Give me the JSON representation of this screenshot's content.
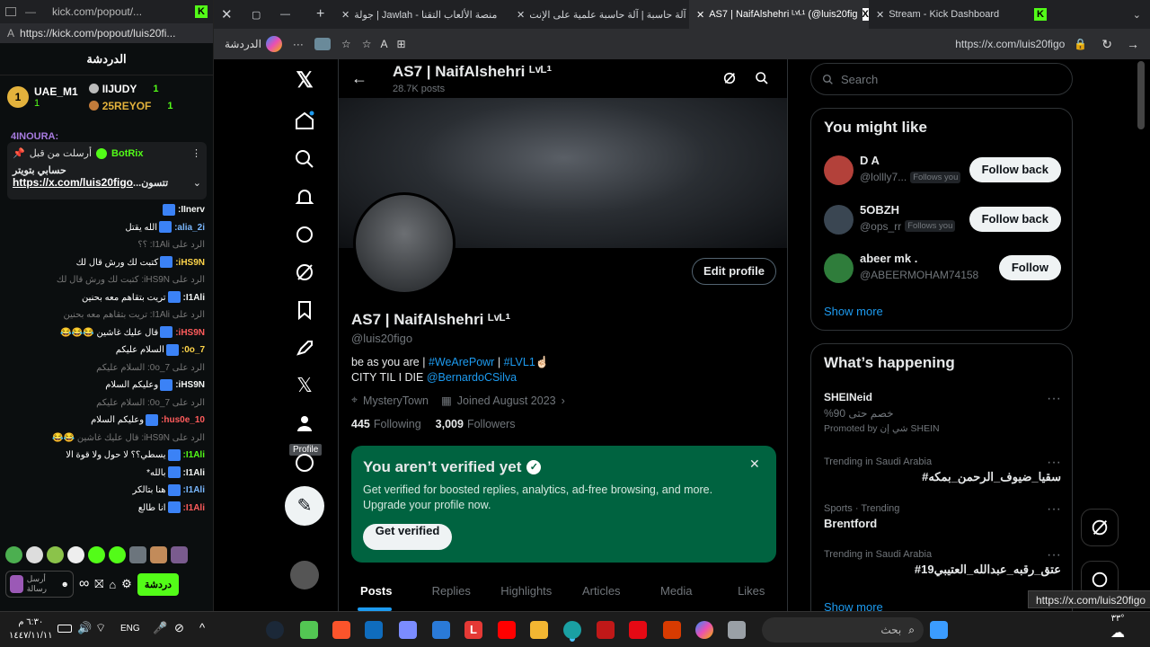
{
  "kick": {
    "tab_title": "kick.com/popout/...",
    "url": "https://kick.com/popout/luis20fi...",
    "chat_title": "الدردشة",
    "leaderboard": [
      {
        "rank": "1",
        "name": "UAE_M1",
        "count": "1"
      },
      {
        "rank": "",
        "name": "IIJUDY",
        "count": "1"
      },
      {
        "rank": "",
        "name": "25REYOF",
        "count": "1"
      }
    ],
    "overflow_user": "4INOURA:",
    "pinned": {
      "by": "أرسلت من قبل",
      "bot": "BotRix",
      "line1": "حسابي بتويتر",
      "link": "https://x.com/luis20figo",
      "suffix": "...تتسون"
    },
    "messages": [
      {
        "user": "IInerv:",
        "text": "",
        "sub": false
      },
      {
        "user": "alia_2i:",
        "text": "الله يقتل",
        "sub": false
      },
      {
        "user": "",
        "text": "الرد على I1Ali: ؟؟",
        "sub": true
      },
      {
        "user": "iHS9N:",
        "text": "كتبت لك ورش قال لك",
        "sub": false
      },
      {
        "user": "",
        "text": "الرد على iHS9N: كتبت لك ورش قال لك",
        "sub": true
      },
      {
        "user": "I1Ali:",
        "text": "تريت بتقاهم معه بحنين",
        "sub": false
      },
      {
        "user": "",
        "text": "الرد على I1Ali: تريت بتقاهم معه بحنين",
        "sub": true
      },
      {
        "user": "iHS9N:",
        "text": "قال عليك غاشين 😂😂😂",
        "sub": false
      },
      {
        "user": "7_0o:",
        "text": "السلام عليكم",
        "sub": false
      },
      {
        "user": "",
        "text": "الرد على 7_0o: السلام عليكم",
        "sub": true
      },
      {
        "user": "iHS9N:",
        "text": "وعليكم السلام",
        "sub": false
      },
      {
        "user": "",
        "text": "الرد على 7_0o: السلام عليكم",
        "sub": true
      },
      {
        "user": "hus0e_10:",
        "text": "وعليكم السلام",
        "sub": false
      },
      {
        "user": "",
        "text": "الرد على iHS9N: قال عليك غاشين 😂😂",
        "sub": true
      },
      {
        "user": "I1Ali:",
        "text": "يسطي؟؟ لا حول ولا قوة الا",
        "sub": false
      },
      {
        "user": "I1Ali:",
        "text": "بالله*",
        "sub": false
      },
      {
        "user": "I1Ali:",
        "text": "هنا بتالكر",
        "sub": false
      },
      {
        "user": "I1Ali:",
        "text": "انا طالع",
        "sub": false
      }
    ],
    "input_placeholder": "أرسل رسالة",
    "send_label": "دردشة"
  },
  "browser": {
    "tabs": [
      {
        "label": "جولة | Jawlah - منصة الألعاب التقنا"
      },
      {
        "label": "آلة حاسبة | آلة حاسبة علمية على الإنت"
      },
      {
        "label": "AS7 | NaifAlshehri ᴸᵛᴸ¹ (@luis20fig"
      },
      {
        "label": "Stream - Kick Dashboard"
      }
    ],
    "url": "https://x.com/luis20figo",
    "chat_button": "الدردشة"
  },
  "profile": {
    "header_name": "AS7 | NaifAlshehri ᴸᵛᴸ¹",
    "posts_count": "28.7K posts",
    "name": "AS7 | NaifAlshehri ᴸᵛᴸ¹",
    "handle": "@luis20figo",
    "bio_line1_a": "be as you are | ",
    "bio_tag1": "#WeArePowr",
    "bio_sep": " | ",
    "bio_tag2": "#LVL1",
    "bio_emoji": "☝🏻",
    "bio_line2": "CITY TIL I DIE ",
    "bio_mention": "@BernardoCSilva",
    "location": "MysteryTown",
    "joined": "Joined August 2023",
    "following_count": "445",
    "following_label": "Following",
    "followers_count": "3,009",
    "followers_label": "Followers",
    "edit_button": "Edit profile",
    "tooltip": "Profile"
  },
  "verify": {
    "title": "You aren’t verified yet",
    "body": "Get verified for boosted replies, analytics, ad-free browsing, and more. Upgrade your profile now.",
    "button": "Get verified",
    "bg": "#006340"
  },
  "tabs": [
    "Posts",
    "Replies",
    "Highlights",
    "Articles",
    "Media",
    "Likes"
  ],
  "search": {
    "placeholder": "Search"
  },
  "might_like": {
    "title": "You might like",
    "users": [
      {
        "name": "D A",
        "handle": "@lollly7...",
        "follows": "Follows you",
        "button": "Follow back"
      },
      {
        "name": "5OBZH",
        "handle": "@ops_rr",
        "follows": "Follows you",
        "button": "Follow back"
      },
      {
        "name": "abeer mk .",
        "handle": "@ABEERMOHAM74158",
        "follows": "",
        "button": "Follow"
      }
    ],
    "show_more": "Show more"
  },
  "happening": {
    "title": "What’s happening",
    "items": [
      {
        "meta": "SHEINeid",
        "title": "خصم حتى 90%",
        "promo": "Promoted by شي إن SHEIN"
      },
      {
        "meta": "Trending in Saudi Arabia",
        "title": "#سقيا_ضيوف_الرحمن_بمكه"
      },
      {
        "meta": "Sports · Trending",
        "title": "Brentford"
      },
      {
        "meta": "Trending in Saudi Arabia",
        "title": "#عتق_رقبه_عبدالله_العتيبي19"
      }
    ],
    "show_more": "Show more"
  },
  "status_url": "https://x.com/luis20figo",
  "taskbar": {
    "time": "٦:٣٠ م",
    "date": "١٤٤٧/١١/١١",
    "lang": "ENG",
    "search_placeholder": "بحث",
    "temp": "٣٣°"
  },
  "colors": {
    "accent": "#1d9bf0",
    "kick_green": "#53fc18"
  }
}
